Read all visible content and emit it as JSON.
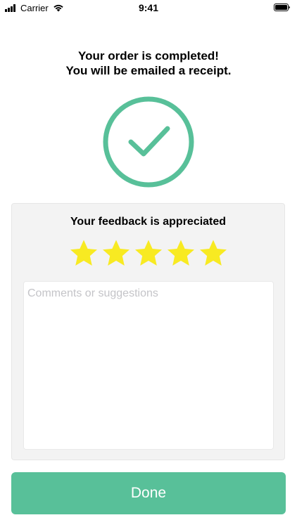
{
  "status_bar": {
    "carrier": "Carrier",
    "time": "9:41",
    "signal_icon": "cellular-signal-icon",
    "wifi_icon": "wifi-icon",
    "battery_icon": "battery-icon"
  },
  "confirmation": {
    "line1": "Your order is completed!",
    "line2": "You will be emailed a receipt.",
    "icon": "checkmark-circle-icon",
    "accent_color": "#58c099"
  },
  "feedback": {
    "title": "Your feedback is appreciated",
    "rating": 5,
    "rating_max": 5,
    "star_color": "#f8ea22",
    "comments_placeholder": "Comments or suggestions",
    "comments_value": ""
  },
  "done_button": {
    "label": "Done",
    "color": "#58c099"
  }
}
